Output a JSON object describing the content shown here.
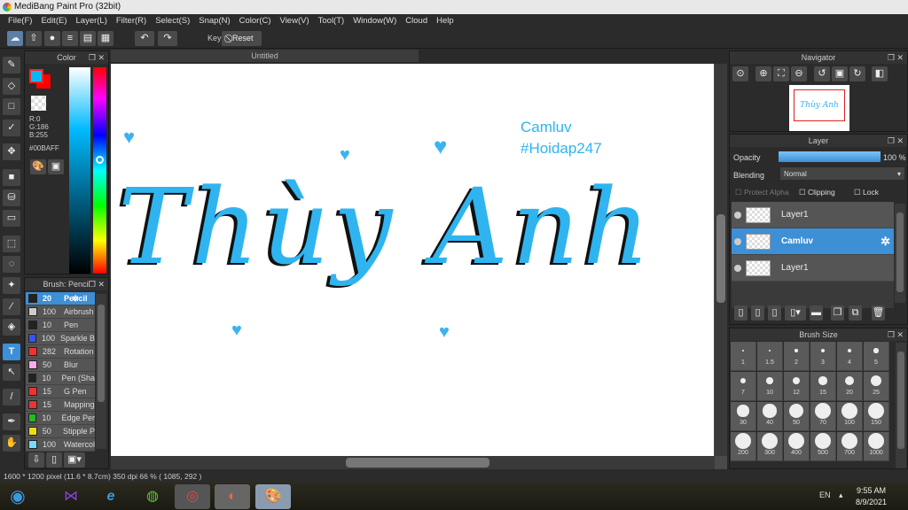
{
  "app": {
    "title": "MediBang Paint Pro (32bit)"
  },
  "menu": [
    "File(F)",
    "Edit(E)",
    "Layer(L)",
    "Filter(R)",
    "Select(S)",
    "Snap(N)",
    "Color(C)",
    "View(V)",
    "Tool(T)",
    "Window(W)",
    "Cloud",
    "Help"
  ],
  "toolbar": {
    "key_label": "Key",
    "reset_label": "Reset"
  },
  "color_panel": {
    "title": "Color",
    "r": "R:0",
    "g": "G:186",
    "b": "B:255",
    "hex": "#00BAFF",
    "foreground": "#00BAFF",
    "background": "#FF0000"
  },
  "brush_panel": {
    "title": "Brush: Pencil",
    "brushes": [
      {
        "size": "20",
        "name": "Pencil",
        "color": "#222222",
        "selected": true
      },
      {
        "size": "100",
        "name": "Airbrush",
        "color": "#cccccc"
      },
      {
        "size": "10",
        "name": "Pen",
        "color": "#222222"
      },
      {
        "size": "100",
        "name": "Sparkle B",
        "color": "#3355ff"
      },
      {
        "size": "282",
        "name": "Rotation",
        "color": "#ee3333"
      },
      {
        "size": "50",
        "name": "Blur",
        "color": "#ffaaee"
      },
      {
        "size": "10",
        "name": "Pen (Sha",
        "color": "#222222"
      },
      {
        "size": "15",
        "name": "G Pen",
        "color": "#ee3333"
      },
      {
        "size": "15",
        "name": "Mapping",
        "color": "#ee3333"
      },
      {
        "size": "10",
        "name": "Edge Per",
        "color": "#22bb22"
      },
      {
        "size": "50",
        "name": "Stipple P",
        "color": "#eedd11"
      },
      {
        "size": "100",
        "name": "Watercol",
        "color": "#77ddff"
      }
    ]
  },
  "canvas": {
    "tab": "Untitled",
    "main_text": "Thùy Anh",
    "watermark_line1": "Camluv",
    "watermark_line2": "#Hoidap247",
    "accent": "#2FB4F0"
  },
  "navigator": {
    "title": "Navigator"
  },
  "layer_panel": {
    "title": "Layer",
    "opacity_label": "Opacity",
    "opacity_value": "100 %",
    "opacity": 100,
    "blending_label": "Blending",
    "blending_value": "Normal",
    "protect_alpha": "Protect Alpha",
    "clipping": "Clipping",
    "lock": "Lock",
    "layers": [
      {
        "name": "Layer1",
        "selected": false
      },
      {
        "name": "Camluv",
        "selected": true
      },
      {
        "name": "Layer1",
        "selected": false
      }
    ]
  },
  "brush_size": {
    "title": "Brush Size",
    "sizes": [
      "1",
      "1.5",
      "2",
      "3",
      "4",
      "5",
      "7",
      "10",
      "12",
      "15",
      "20",
      "25",
      "30",
      "40",
      "50",
      "70",
      "100",
      "150",
      "200",
      "300",
      "400",
      "500",
      "700",
      "1000"
    ]
  },
  "status": "1600 * 1200 pixel  (11.6 * 8.7cm)  350 dpi  66 %  ( 1085, 292 )",
  "taskbar": {
    "lang": "EN",
    "time": "9:55 AM",
    "date": "8/9/2021"
  }
}
